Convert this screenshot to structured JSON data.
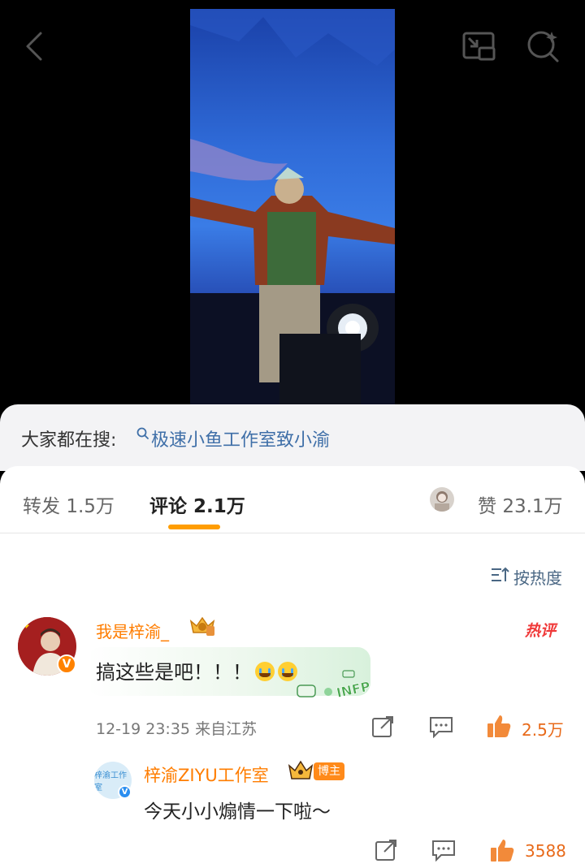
{
  "photo": {
    "description_icon": "concert-photo"
  },
  "search": {
    "label": "大家都在搜:",
    "term": "极速小鱼工作室致小渝"
  },
  "tabs": [
    {
      "label": "转发",
      "count": "1.5万"
    },
    {
      "label": "评论",
      "count": "2.1万"
    },
    {
      "label": "赞",
      "count": "23.1万"
    }
  ],
  "sort": {
    "label": "按热度"
  },
  "comments": [
    {
      "username": "我是梓渝_",
      "text": "搞这些是吧！！！",
      "time": "12-19 23:35",
      "location": "来自江苏",
      "likes": "2.5万",
      "hot_label": "热评",
      "decoration_text": "INFP"
    },
    {
      "username": "梓渝ZIYU工作室",
      "author_badge": "博主",
      "avatar_text": "梓渝工作室",
      "text": "今天小小煽情一下啦～",
      "likes": "3588"
    }
  ],
  "colors": {
    "accent": "#ff9d00",
    "username": "#ff7d00",
    "link": "#3f6fa8",
    "hot": "#f03a3a"
  }
}
